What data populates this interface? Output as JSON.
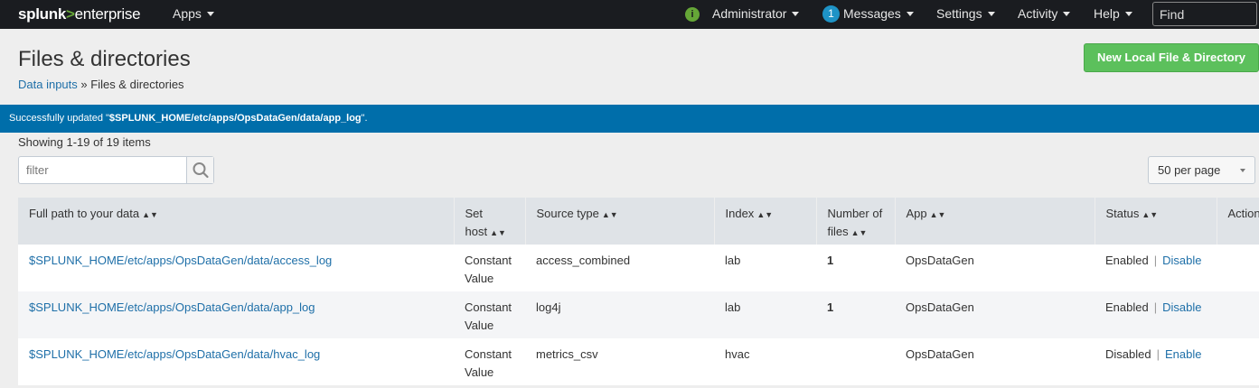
{
  "topbar": {
    "logo_splunk": "splunk",
    "logo_gt": ">",
    "logo_enterprise": "enterprise",
    "apps_label": "Apps",
    "admin_label": "Administrator",
    "messages_count": "1",
    "messages_label": "Messages",
    "settings_label": "Settings",
    "activity_label": "Activity",
    "help_label": "Help",
    "find_placeholder": "Find"
  },
  "header": {
    "title": "Files & directories",
    "breadcrumb_link": "Data inputs",
    "breadcrumb_sep": "»",
    "breadcrumb_current": "Files & directories",
    "new_button": "New Local File & Directory"
  },
  "banner": {
    "prefix": "Successfully updated \"",
    "path": "$SPLUNK_HOME/etc/apps/OpsDataGen/data/app_log",
    "suffix": "\"."
  },
  "list": {
    "showing": "Showing 1-19 of 19 items",
    "filter_placeholder": "filter",
    "per_page": "50 per page"
  },
  "table": {
    "columns": [
      "Full path to your data",
      "Set host",
      "Source type",
      "Index",
      "Number of files",
      "App",
      "Status",
      "Actions"
    ],
    "rows": [
      {
        "path": "$SPLUNK_HOME/etc/apps/OpsDataGen/data/access_log",
        "host": "Constant Value",
        "sourcetype": "access_combined",
        "index": "lab",
        "files": "1",
        "app": "OpsDataGen",
        "status": "Enabled",
        "sep": "|",
        "action": "Disable"
      },
      {
        "path": "$SPLUNK_HOME/etc/apps/OpsDataGen/data/app_log",
        "host": "Constant Value",
        "sourcetype": "log4j",
        "index": "lab",
        "files": "1",
        "app": "OpsDataGen",
        "status": "Enabled",
        "sep": "|",
        "action": "Disable"
      },
      {
        "path": "$SPLUNK_HOME/etc/apps/OpsDataGen/data/hvac_log",
        "host": "Constant Value",
        "sourcetype": "metrics_csv",
        "index": "hvac",
        "files": "",
        "app": "OpsDataGen",
        "status": "Disabled",
        "sep": "|",
        "action": "Enable"
      }
    ]
  },
  "colors": {
    "topbar": "#1a1c20",
    "banner": "#006eaa",
    "primary_button": "#5cc05c",
    "link": "#1e6fa8",
    "info_icon": "#65a637",
    "badge": "#1e93c6"
  },
  "icons": [
    "info-icon",
    "search-icon",
    "sort-icon",
    "caret-down-icon"
  ]
}
